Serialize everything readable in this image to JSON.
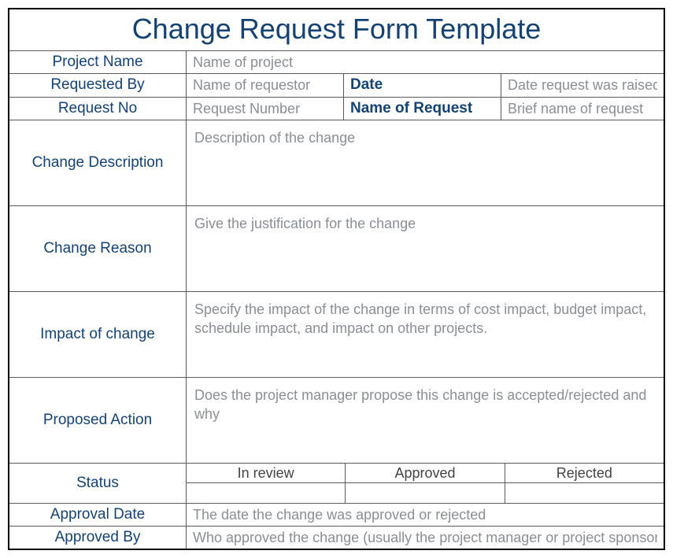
{
  "title": "Change Request Form Template",
  "fields": {
    "projectName": {
      "label": "Project Name",
      "placeholder": "Name of project"
    },
    "requestedBy": {
      "label": "Requested By",
      "placeholder": "Name of requestor"
    },
    "date": {
      "label": "Date",
      "placeholder": "Date request was raised"
    },
    "requestNo": {
      "label": "Request No",
      "placeholder": "Request Number"
    },
    "nameOfRequest": {
      "label": "Name of Request",
      "placeholder": "Brief name of request"
    },
    "changeDescription": {
      "label": "Change Description",
      "placeholder": "Description of the change"
    },
    "changeReason": {
      "label": "Change Reason",
      "placeholder": "Give the justification for the change"
    },
    "impactOfChange": {
      "label": "Impact of change",
      "placeholder": "Specify the impact of the change in terms of cost impact, budget impact, schedule impact, and impact on other projects."
    },
    "proposedAction": {
      "label": "Proposed Action",
      "placeholder": "Does the project manager propose this change is accepted/rejected and why"
    },
    "status": {
      "label": "Status",
      "options": [
        "In review",
        "Approved",
        "Rejected"
      ]
    },
    "approvalDate": {
      "label": "Approval Date",
      "placeholder": "The date the change was approved or rejected"
    },
    "approvedBy": {
      "label": "Approved By",
      "placeholder": "Who approved the change (usually the project manager or project sponsor)"
    }
  }
}
